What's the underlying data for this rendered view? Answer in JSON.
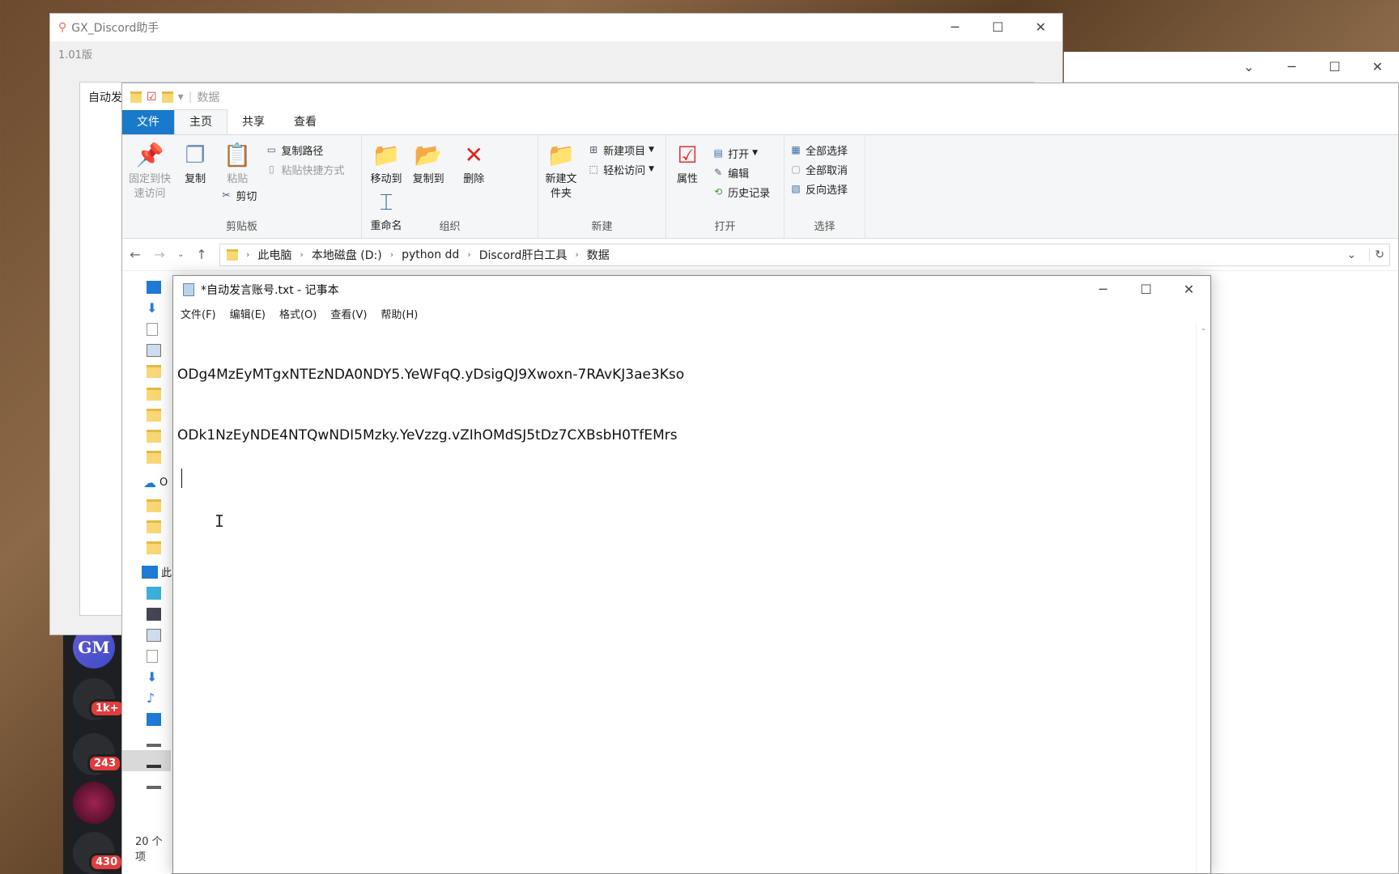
{
  "discord": {
    "badges": [
      "1k+",
      "243",
      "430"
    ],
    "server_initials": "GM"
  },
  "gx_window": {
    "title": "GX_Discord助手",
    "version": "1.01版",
    "tab_partial": "自动发"
  },
  "explorer": {
    "quick_access_title": "数据",
    "tabs": [
      "文件",
      "主页",
      "共享",
      "查看"
    ],
    "ribbon": {
      "clipboard": {
        "pin": "固定到快速访问",
        "copy": "复制",
        "paste": "粘贴",
        "copy_path": "复制路径",
        "paste_shortcut": "粘贴快捷方式",
        "cut": "剪切",
        "label": "剪贴板"
      },
      "organize": {
        "move_to": "移动到",
        "copy_to": "复制到",
        "delete": "删除",
        "rename": "重命名",
        "label": "组织"
      },
      "new": {
        "new_folder": "新建文件夹",
        "new_item": "新建项目",
        "easy_access": "轻松访问",
        "label": "新建"
      },
      "open": {
        "properties": "属性",
        "open": "打开",
        "edit": "编辑",
        "history": "历史记录",
        "label": "打开"
      },
      "select": {
        "select_all": "全部选择",
        "select_none": "全部取消",
        "invert": "反向选择",
        "label": "选择"
      }
    },
    "breadcrumb": [
      "此电脑",
      "本地磁盘 (D:)",
      "python dd",
      "Discord肝白工具",
      "数据"
    ],
    "sidebar_partial": {
      "onedrive": "O",
      "this_pc": "此"
    },
    "status": "20 个项"
  },
  "notepad": {
    "title": "*自动发言账号.txt - 记事本",
    "menu": [
      "文件(F)",
      "编辑(E)",
      "格式(O)",
      "查看(V)",
      "帮助(H)"
    ],
    "lines": [
      "ODg4MzEyMTgxNTEzNDA0NDY5.YeWFqQ.yDsigQJ9Xwoxn-7RAvKJ3ae3Kso",
      "ODk1NzEyNDE4NTQwNDI5Mzky.YeVzzg.vZIhOMdSJ5tDz7CXBsbH0TfEMrs"
    ]
  }
}
